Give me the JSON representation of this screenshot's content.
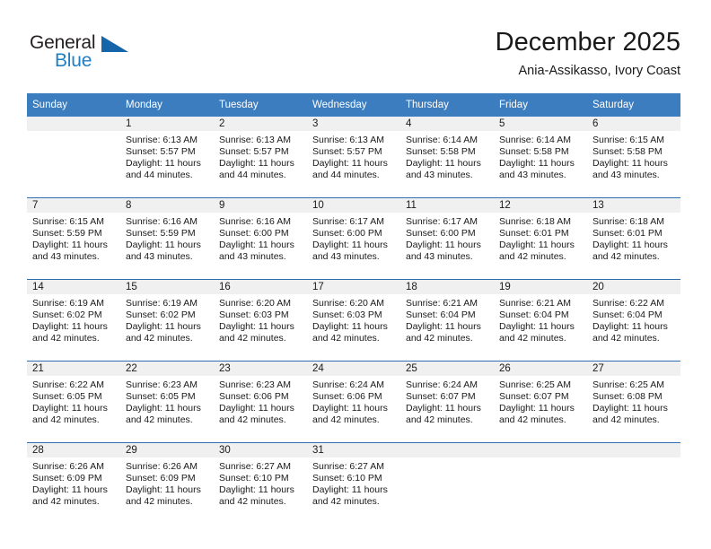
{
  "logo": {
    "primary_text": "General",
    "secondary_text": "Blue",
    "primary_color": "#231f20",
    "secondary_color": "#1f7fc4",
    "triangle_color": "#1565a8"
  },
  "header": {
    "title": "December 2025",
    "subtitle": "Ania-Assikasso, Ivory Coast"
  },
  "theme": {
    "header_bg": "#3b7dbf",
    "header_text": "#ffffff",
    "daynum_bg": "#f0f0f0",
    "row_separator": "#2f6fb0",
    "body_text": "#1a1a1a"
  },
  "calendar": {
    "weekday_headers": [
      "Sunday",
      "Monday",
      "Tuesday",
      "Wednesday",
      "Thursday",
      "Friday",
      "Saturday"
    ],
    "weeks": [
      [
        {
          "day": "",
          "empty": true
        },
        {
          "day": "1",
          "sunrise": "Sunrise: 6:13 AM",
          "sunset": "Sunset: 5:57 PM",
          "daylight1": "Daylight: 11 hours",
          "daylight2": "and 44 minutes."
        },
        {
          "day": "2",
          "sunrise": "Sunrise: 6:13 AM",
          "sunset": "Sunset: 5:57 PM",
          "daylight1": "Daylight: 11 hours",
          "daylight2": "and 44 minutes."
        },
        {
          "day": "3",
          "sunrise": "Sunrise: 6:13 AM",
          "sunset": "Sunset: 5:57 PM",
          "daylight1": "Daylight: 11 hours",
          "daylight2": "and 44 minutes."
        },
        {
          "day": "4",
          "sunrise": "Sunrise: 6:14 AM",
          "sunset": "Sunset: 5:58 PM",
          "daylight1": "Daylight: 11 hours",
          "daylight2": "and 43 minutes."
        },
        {
          "day": "5",
          "sunrise": "Sunrise: 6:14 AM",
          "sunset": "Sunset: 5:58 PM",
          "daylight1": "Daylight: 11 hours",
          "daylight2": "and 43 minutes."
        },
        {
          "day": "6",
          "sunrise": "Sunrise: 6:15 AM",
          "sunset": "Sunset: 5:58 PM",
          "daylight1": "Daylight: 11 hours",
          "daylight2": "and 43 minutes."
        }
      ],
      [
        {
          "day": "7",
          "sunrise": "Sunrise: 6:15 AM",
          "sunset": "Sunset: 5:59 PM",
          "daylight1": "Daylight: 11 hours",
          "daylight2": "and 43 minutes."
        },
        {
          "day": "8",
          "sunrise": "Sunrise: 6:16 AM",
          "sunset": "Sunset: 5:59 PM",
          "daylight1": "Daylight: 11 hours",
          "daylight2": "and 43 minutes."
        },
        {
          "day": "9",
          "sunrise": "Sunrise: 6:16 AM",
          "sunset": "Sunset: 6:00 PM",
          "daylight1": "Daylight: 11 hours",
          "daylight2": "and 43 minutes."
        },
        {
          "day": "10",
          "sunrise": "Sunrise: 6:17 AM",
          "sunset": "Sunset: 6:00 PM",
          "daylight1": "Daylight: 11 hours",
          "daylight2": "and 43 minutes."
        },
        {
          "day": "11",
          "sunrise": "Sunrise: 6:17 AM",
          "sunset": "Sunset: 6:00 PM",
          "daylight1": "Daylight: 11 hours",
          "daylight2": "and 43 minutes."
        },
        {
          "day": "12",
          "sunrise": "Sunrise: 6:18 AM",
          "sunset": "Sunset: 6:01 PM",
          "daylight1": "Daylight: 11 hours",
          "daylight2": "and 42 minutes."
        },
        {
          "day": "13",
          "sunrise": "Sunrise: 6:18 AM",
          "sunset": "Sunset: 6:01 PM",
          "daylight1": "Daylight: 11 hours",
          "daylight2": "and 42 minutes."
        }
      ],
      [
        {
          "day": "14",
          "sunrise": "Sunrise: 6:19 AM",
          "sunset": "Sunset: 6:02 PM",
          "daylight1": "Daylight: 11 hours",
          "daylight2": "and 42 minutes."
        },
        {
          "day": "15",
          "sunrise": "Sunrise: 6:19 AM",
          "sunset": "Sunset: 6:02 PM",
          "daylight1": "Daylight: 11 hours",
          "daylight2": "and 42 minutes."
        },
        {
          "day": "16",
          "sunrise": "Sunrise: 6:20 AM",
          "sunset": "Sunset: 6:03 PM",
          "daylight1": "Daylight: 11 hours",
          "daylight2": "and 42 minutes."
        },
        {
          "day": "17",
          "sunrise": "Sunrise: 6:20 AM",
          "sunset": "Sunset: 6:03 PM",
          "daylight1": "Daylight: 11 hours",
          "daylight2": "and 42 minutes."
        },
        {
          "day": "18",
          "sunrise": "Sunrise: 6:21 AM",
          "sunset": "Sunset: 6:04 PM",
          "daylight1": "Daylight: 11 hours",
          "daylight2": "and 42 minutes."
        },
        {
          "day": "19",
          "sunrise": "Sunrise: 6:21 AM",
          "sunset": "Sunset: 6:04 PM",
          "daylight1": "Daylight: 11 hours",
          "daylight2": "and 42 minutes."
        },
        {
          "day": "20",
          "sunrise": "Sunrise: 6:22 AM",
          "sunset": "Sunset: 6:04 PM",
          "daylight1": "Daylight: 11 hours",
          "daylight2": "and 42 minutes."
        }
      ],
      [
        {
          "day": "21",
          "sunrise": "Sunrise: 6:22 AM",
          "sunset": "Sunset: 6:05 PM",
          "daylight1": "Daylight: 11 hours",
          "daylight2": "and 42 minutes."
        },
        {
          "day": "22",
          "sunrise": "Sunrise: 6:23 AM",
          "sunset": "Sunset: 6:05 PM",
          "daylight1": "Daylight: 11 hours",
          "daylight2": "and 42 minutes."
        },
        {
          "day": "23",
          "sunrise": "Sunrise: 6:23 AM",
          "sunset": "Sunset: 6:06 PM",
          "daylight1": "Daylight: 11 hours",
          "daylight2": "and 42 minutes."
        },
        {
          "day": "24",
          "sunrise": "Sunrise: 6:24 AM",
          "sunset": "Sunset: 6:06 PM",
          "daylight1": "Daylight: 11 hours",
          "daylight2": "and 42 minutes."
        },
        {
          "day": "25",
          "sunrise": "Sunrise: 6:24 AM",
          "sunset": "Sunset: 6:07 PM",
          "daylight1": "Daylight: 11 hours",
          "daylight2": "and 42 minutes."
        },
        {
          "day": "26",
          "sunrise": "Sunrise: 6:25 AM",
          "sunset": "Sunset: 6:07 PM",
          "daylight1": "Daylight: 11 hours",
          "daylight2": "and 42 minutes."
        },
        {
          "day": "27",
          "sunrise": "Sunrise: 6:25 AM",
          "sunset": "Sunset: 6:08 PM",
          "daylight1": "Daylight: 11 hours",
          "daylight2": "and 42 minutes."
        }
      ],
      [
        {
          "day": "28",
          "sunrise": "Sunrise: 6:26 AM",
          "sunset": "Sunset: 6:09 PM",
          "daylight1": "Daylight: 11 hours",
          "daylight2": "and 42 minutes."
        },
        {
          "day": "29",
          "sunrise": "Sunrise: 6:26 AM",
          "sunset": "Sunset: 6:09 PM",
          "daylight1": "Daylight: 11 hours",
          "daylight2": "and 42 minutes."
        },
        {
          "day": "30",
          "sunrise": "Sunrise: 6:27 AM",
          "sunset": "Sunset: 6:10 PM",
          "daylight1": "Daylight: 11 hours",
          "daylight2": "and 42 minutes."
        },
        {
          "day": "31",
          "sunrise": "Sunrise: 6:27 AM",
          "sunset": "Sunset: 6:10 PM",
          "daylight1": "Daylight: 11 hours",
          "daylight2": "and 42 minutes."
        },
        {
          "day": "",
          "empty": true
        },
        {
          "day": "",
          "empty": true
        },
        {
          "day": "",
          "empty": true
        }
      ]
    ]
  }
}
